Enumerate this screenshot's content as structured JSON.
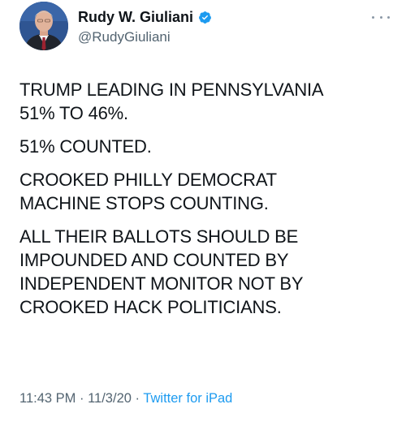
{
  "author": {
    "display_name": "Rudy W. Giuliani",
    "handle": "@RudyGiuliani",
    "verified": true,
    "verified_color": "#1d9bf0"
  },
  "tweet": {
    "paragraphs": [
      "TRUMP LEADING IN PENNSYLVANIA\n51% TO 46%.",
      "51% COUNTED.",
      "CROOKED PHILLY DEMOCRAT\nMACHINE STOPS COUNTING.",
      "ALL THEIR BALLOTS SHOULD BE\nIMPOUNDED AND COUNTED BY\nINDEPENDENT MONITOR  NOT BY\nCROOKED HACK POLITICIANS."
    ]
  },
  "meta": {
    "time": "11:43 PM",
    "separator": "·",
    "date": "11/3/20",
    "source": "Twitter for iPad"
  },
  "icons": {
    "more": "more-options-icon",
    "verified": "verified-badge-icon",
    "avatar": "profile-avatar"
  }
}
